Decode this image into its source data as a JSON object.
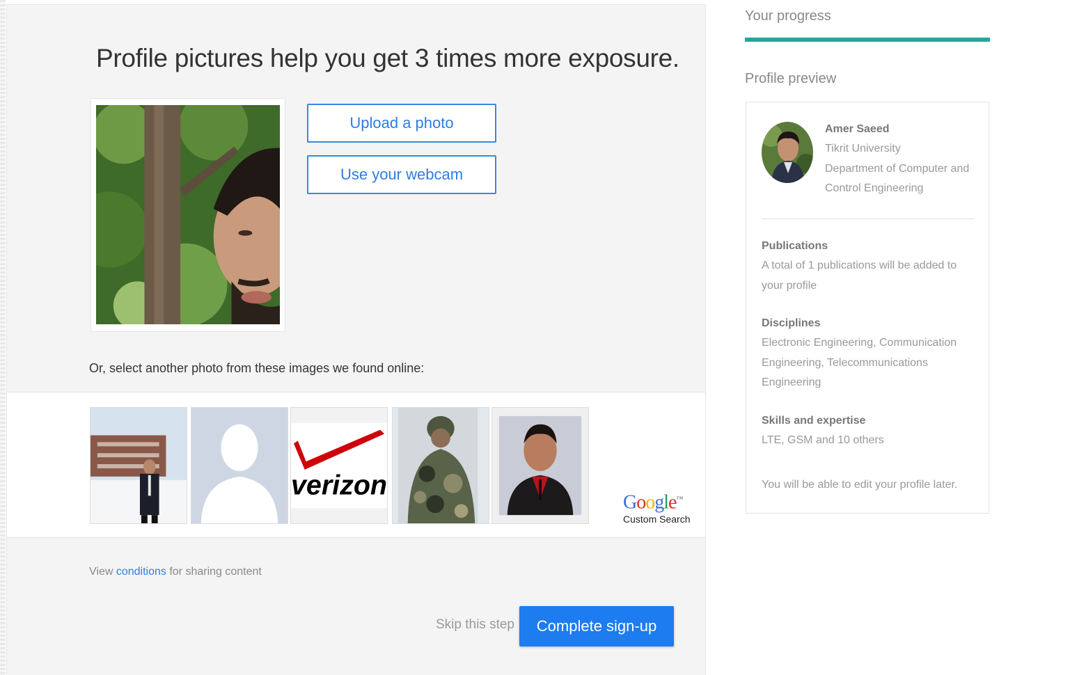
{
  "main": {
    "headline": "Profile pictures help you get 3 times more exposure.",
    "upload_label": "Upload a photo",
    "webcam_label": "Use your webcam",
    "select_label": "Or, select another photo from these images we found online:",
    "thumbnails": [
      {
        "subject": "man in suit outdoors in snow"
      },
      {
        "subject": "default silhouette placeholder"
      },
      {
        "subject": "verizon logo",
        "logo_text": "verizon"
      },
      {
        "subject": "man in camouflage jacket"
      },
      {
        "subject": "portrait of man in red shirt"
      }
    ],
    "google": {
      "letters": [
        "G",
        "o",
        "o",
        "g",
        "l",
        "e"
      ],
      "letter_colors": [
        "#3b6fd8",
        "#d93025",
        "#f2b500",
        "#3b6fd8",
        "#1e9e4a",
        "#d93025"
      ],
      "trademark": "™",
      "sub": "Custom Search"
    },
    "conditions": {
      "prefix": "View ",
      "link": "conditions",
      "suffix": " for sharing content"
    },
    "skip_label": "Skip this step",
    "complete_label": "Complete sign-up"
  },
  "sidebar": {
    "progress_label": "Your progress",
    "progress_fraction": 1.0,
    "preview_label": "Profile preview",
    "profile": {
      "name": "Amer Saeed",
      "lines": [
        "Tikrit University",
        "Department of Computer and",
        "Control Engineering"
      ]
    },
    "sections": [
      {
        "title": "Publications",
        "lines": [
          "A total of 1 publications will be added to",
          "your profile"
        ]
      },
      {
        "title": "Disciplines",
        "lines": [
          "Electronic Engineering, Communication",
          "Engineering, Telecommunications",
          "Engineering"
        ]
      },
      {
        "title": "Skills and expertise",
        "lines": [
          "LTE, GSM and 10 others"
        ]
      }
    ],
    "edit_note": "You will be able to edit your profile later."
  },
  "colors": {
    "accent_blue": "#1c7cf0",
    "progress_teal": "#26a69a",
    "panel_bg": "#f4f4f4"
  }
}
